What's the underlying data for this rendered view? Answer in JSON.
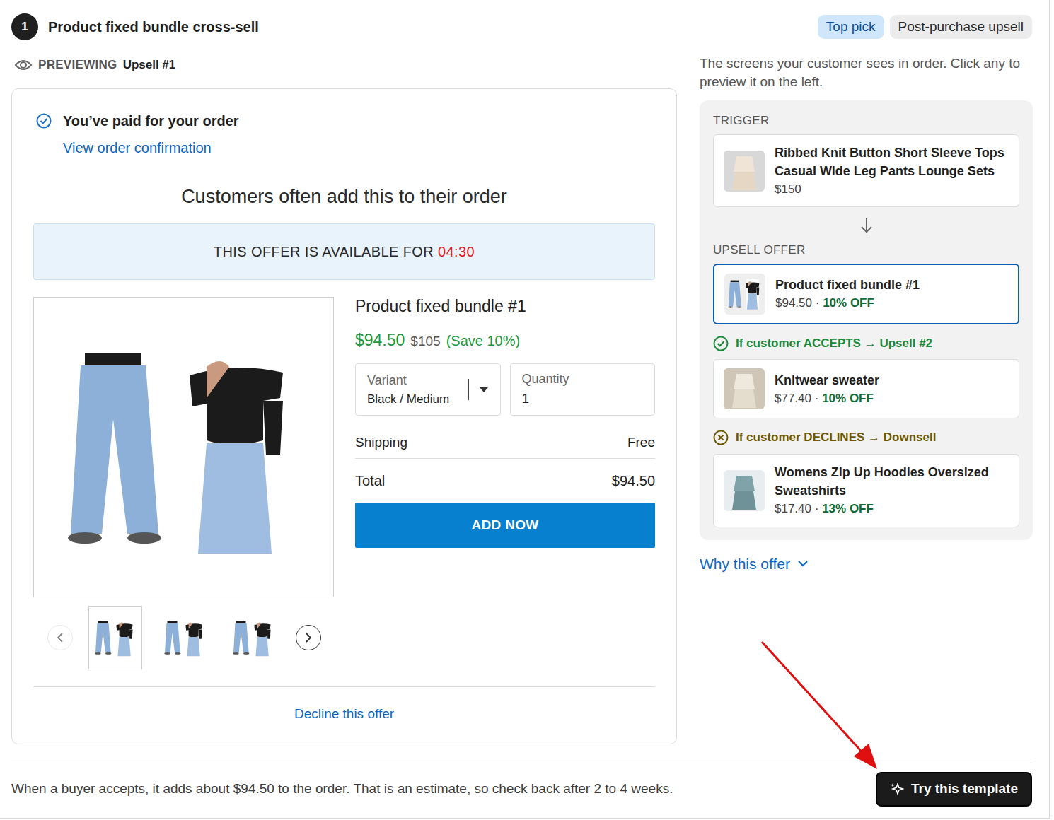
{
  "step": "1",
  "title": "Product fixed bundle cross-sell",
  "chips": [
    {
      "label": "Top pick",
      "color": "#cfe6fb"
    },
    {
      "label": "Post-purchase upsell",
      "color": "#ececec"
    }
  ],
  "preview": {
    "label": "PREVIEWING",
    "value": "Upsell #1"
  },
  "checkout": {
    "paid": "You’ve paid for your order",
    "confirmation_link": "View order confirmation",
    "heading": "Customers often add this to their order",
    "timer": {
      "label": "THIS OFFER IS AVAILABLE FOR",
      "time": "04:30"
    },
    "product": {
      "title": "Product fixed bundle #1",
      "price": "$94.50",
      "compare_price": "$105",
      "savings": "(Save 10%)"
    },
    "thumbnails": [
      {
        "selected": true
      },
      {
        "selected": false
      },
      {
        "selected": false
      }
    ],
    "carousel": {
      "prev_disabled": true,
      "next_disabled": false
    },
    "variant": {
      "label": "Variant",
      "value": "Black / Medium"
    },
    "quantity": {
      "label": "Quantity",
      "value": "1"
    },
    "shipping": {
      "label": "Shipping",
      "value": "Free"
    },
    "total": {
      "label": "Total",
      "value": "$94.50"
    },
    "add_button": "ADD NOW",
    "decline": "Decline this offer"
  },
  "flow": {
    "intro": "The screens your customer sees in order. Click any to preview it on the left.",
    "sep": "·",
    "trigger_label": "TRIGGER",
    "trigger": {
      "title": "Ribbed Knit Button Short Sleeve Tops Casual Wide Leg Pants Lounge Sets",
      "price": "$150"
    },
    "upsell_label": "UPSELL OFFER",
    "offer": {
      "title": "Product fixed bundle #1",
      "price": "$94.50",
      "discount": "10% OFF",
      "selected": true
    },
    "branches": [
      {
        "kind": "accept",
        "label": "If customer ACCEPTS → Upsell #2",
        "title": "Knitwear sweater",
        "price": "$77.40",
        "discount": "10% OFF"
      },
      {
        "kind": "decline",
        "label": "If customer DECLINES → Downsell",
        "title": "Womens Zip Up Hoodies Oversized Sweatshirts",
        "price": "$17.40",
        "discount": "13% OFF"
      }
    ]
  },
  "why": "Why this offer",
  "footer": {
    "note": "When a buyer accepts, it adds about $94.50 to the order. That is an estimate, so check back after 2 to 4 weeks.",
    "button": "Try this template"
  }
}
